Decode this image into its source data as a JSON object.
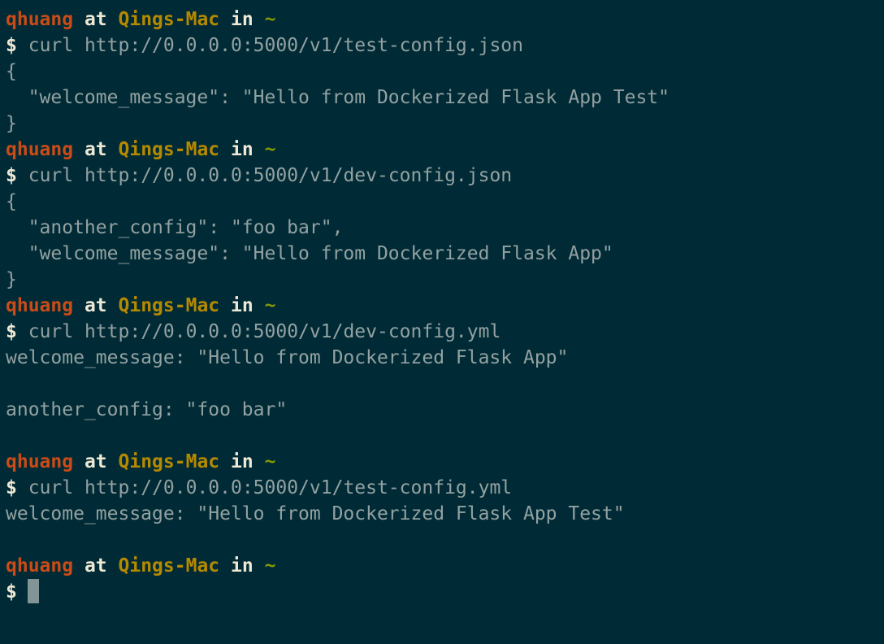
{
  "prompt": {
    "user": "qhuang",
    "at": "at",
    "host": "Qings-Mac",
    "in": "in",
    "dir": "~",
    "symbol": "$"
  },
  "blocks": [
    {
      "command": "curl http://0.0.0.0:5000/v1/test-config.json",
      "output": [
        "{",
        "  \"welcome_message\": \"Hello from Dockerized Flask App Test\"",
        "}"
      ]
    },
    {
      "command": "curl http://0.0.0.0:5000/v1/dev-config.json",
      "output": [
        "{",
        "  \"another_config\": \"foo bar\",",
        "  \"welcome_message\": \"Hello from Dockerized Flask App\"",
        "}"
      ]
    },
    {
      "command": "curl http://0.0.0.0:5000/v1/dev-config.yml",
      "output": [
        "welcome_message: \"Hello from Dockerized Flask App\"",
        "",
        "another_config: \"foo bar\"",
        ""
      ]
    },
    {
      "command": "curl http://0.0.0.0:5000/v1/test-config.yml",
      "output": [
        "welcome_message: \"Hello from Dockerized Flask App Test\"",
        ""
      ]
    }
  ],
  "colors": {
    "background": "#002b36",
    "user": "#cb4b16",
    "host": "#b58900",
    "dir": "#859900",
    "text": "#93a1a1",
    "cursor": "#839496"
  }
}
